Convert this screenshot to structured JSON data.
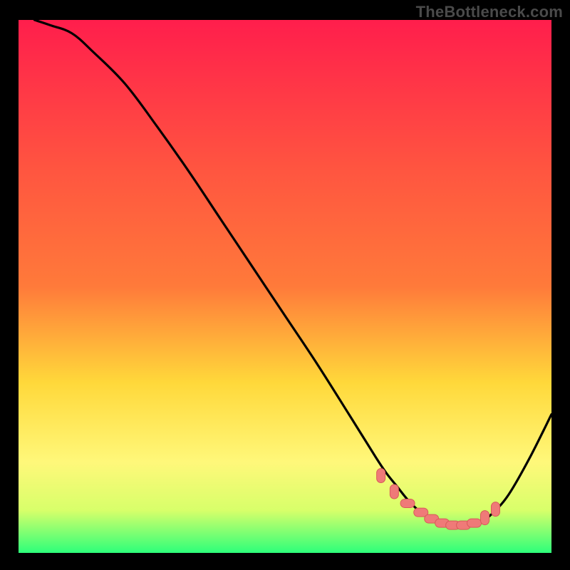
{
  "watermark": "TheBottleneck.com",
  "colors": {
    "gradient_top": "#ff1e4c",
    "gradient_mid1": "#ff7a3a",
    "gradient_mid2": "#ffd83a",
    "gradient_mid3": "#fff87a",
    "gradient_bottom": "#2dff7a",
    "curve": "#000000",
    "marker_fill": "#ef7a78",
    "marker_stroke": "#d85b59",
    "frame_bg": "#000000"
  },
  "chart_data": {
    "type": "line",
    "title": "",
    "xlabel": "",
    "ylabel": "",
    "xlim": [
      0,
      100
    ],
    "ylim": [
      0,
      100
    ],
    "series": [
      {
        "name": "curve",
        "x": [
          3,
          6,
          10,
          14,
          20,
          26,
          32,
          38,
          44,
          50,
          56,
          62,
          67,
          69,
          71,
          73,
          75,
          77,
          79,
          81,
          83,
          85,
          87,
          89,
          92,
          96,
          100
        ],
        "y": [
          100,
          99,
          97.5,
          94,
          88,
          80,
          71.5,
          62.5,
          53.5,
          44.5,
          35.5,
          26,
          18,
          15,
          12.5,
          10,
          8,
          6.5,
          5.5,
          5,
          5,
          5.3,
          6,
          7.5,
          11,
          18,
          26
        ]
      }
    ],
    "markers": {
      "name": "optimal-region",
      "x": [
        68,
        70.5,
        73,
        75.5,
        77.5,
        79.5,
        81.5,
        83.5,
        85.5,
        87.5,
        89.5
      ],
      "y": [
        14.5,
        11.5,
        9.3,
        7.6,
        6.4,
        5.6,
        5.2,
        5.2,
        5.6,
        6.6,
        8.2
      ]
    }
  }
}
